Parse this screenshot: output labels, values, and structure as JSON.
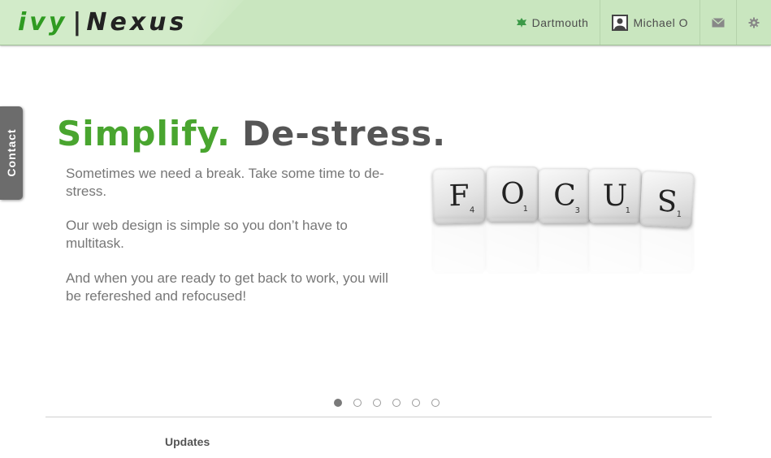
{
  "header": {
    "logo_left": "ivy",
    "logo_sep": "|",
    "logo_right": "Nexus",
    "school": "Dartmouth",
    "user": "Michael O",
    "icons": {
      "school": "leaf-icon",
      "user": "avatar",
      "mail": "mail-icon",
      "settings": "gear-icon"
    }
  },
  "contact_tab": {
    "label": "Contact"
  },
  "hero": {
    "headline_green": "Simplify.",
    "headline_dark": "De-stress.",
    "paragraphs": [
      "Sometimes we need a break. Take some time to de-stress.",
      "Our web design is simple so you don’t have to multitask.",
      "And when you are ready to get back to work, you will be refereshed and refocused!"
    ],
    "tiles": [
      {
        "letter": "F",
        "points": "4"
      },
      {
        "letter": "O",
        "points": "1"
      },
      {
        "letter": "C",
        "points": "3"
      },
      {
        "letter": "U",
        "points": "1"
      },
      {
        "letter": "S",
        "points": "1"
      }
    ]
  },
  "carousel": {
    "count": 6,
    "active_index": 0
  },
  "sections": {
    "updates_title": "Updates"
  },
  "colors": {
    "header_bg": "#c9e6bf",
    "brand_green": "#49a52f",
    "text_gray": "#777777"
  }
}
